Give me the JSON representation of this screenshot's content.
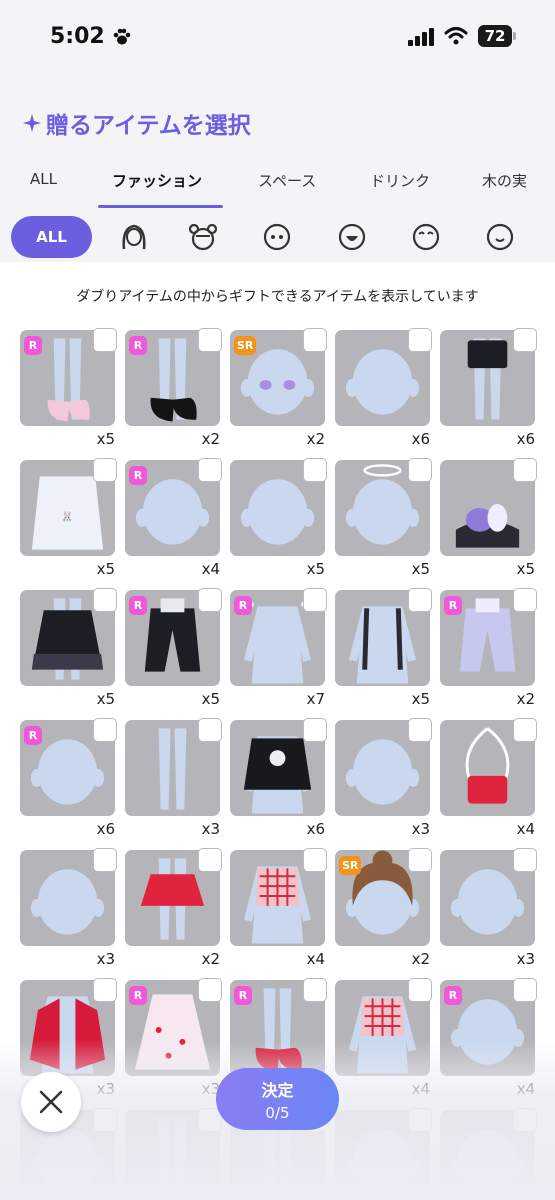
{
  "status_bar": {
    "time": "5:02",
    "battery": "72"
  },
  "header": {
    "title": "贈るアイテムを選択"
  },
  "tabs": [
    {
      "label": "ALL"
    },
    {
      "label": "ファッション"
    },
    {
      "label": "スペース"
    },
    {
      "label": "ドリンク"
    },
    {
      "label": "木の実"
    }
  ],
  "categories": {
    "all_label": "ALL",
    "icons": [
      "hair-icon",
      "face-accessory-icon",
      "eyes-icon",
      "mouth-icon",
      "brow-icon",
      "face-icon"
    ]
  },
  "notice": "ダブりアイテムの中からギフトできるアイテムを表示しています",
  "items": [
    {
      "rarity": "R",
      "count": "x5",
      "kind": "shoes-pink"
    },
    {
      "rarity": "R",
      "count": "x2",
      "kind": "shoes-black"
    },
    {
      "rarity": "SR",
      "count": "x2",
      "kind": "eyes"
    },
    {
      "rarity": "",
      "count": "x6",
      "kind": "face"
    },
    {
      "rarity": "",
      "count": "x6",
      "kind": "shorts"
    },
    {
      "rarity": "",
      "count": "x5",
      "kind": "shirt"
    },
    {
      "rarity": "R",
      "count": "x4",
      "kind": "face"
    },
    {
      "rarity": "",
      "count": "x5",
      "kind": "face"
    },
    {
      "rarity": "",
      "count": "x5",
      "kind": "halo"
    },
    {
      "rarity": "",
      "count": "x5",
      "kind": "slippers"
    },
    {
      "rarity": "",
      "count": "x5",
      "kind": "skirt-black"
    },
    {
      "rarity": "R",
      "count": "x5",
      "kind": "pants"
    },
    {
      "rarity": "R",
      "count": "x7",
      "kind": "wings-body"
    },
    {
      "rarity": "",
      "count": "x5",
      "kind": "suspender"
    },
    {
      "rarity": "R",
      "count": "x2",
      "kind": "pants-blue"
    },
    {
      "rarity": "R",
      "count": "x6",
      "kind": "face"
    },
    {
      "rarity": "",
      "count": "x3",
      "kind": "legs"
    },
    {
      "rarity": "",
      "count": "x6",
      "kind": "tshirt-black"
    },
    {
      "rarity": "",
      "count": "x3",
      "kind": "face"
    },
    {
      "rarity": "",
      "count": "x4",
      "kind": "bag"
    },
    {
      "rarity": "",
      "count": "x3",
      "kind": "face"
    },
    {
      "rarity": "",
      "count": "x2",
      "kind": "skirt-red"
    },
    {
      "rarity": "",
      "count": "x4",
      "kind": "top-check"
    },
    {
      "rarity": "SR",
      "count": "x2",
      "kind": "hair"
    },
    {
      "rarity": "",
      "count": "x3",
      "kind": "face"
    },
    {
      "rarity": "",
      "count": "x3",
      "kind": "cape"
    },
    {
      "rarity": "R",
      "count": "x3",
      "kind": "dress"
    },
    {
      "rarity": "R",
      "count": "x3",
      "kind": "shoes-red"
    },
    {
      "rarity": "",
      "count": "x4",
      "kind": "top-check"
    },
    {
      "rarity": "R",
      "count": "x4",
      "kind": "face"
    },
    {
      "rarity": "",
      "count": "",
      "kind": "face"
    },
    {
      "rarity": "",
      "count": "",
      "kind": "legs"
    },
    {
      "rarity": "",
      "count": "",
      "kind": "legs"
    },
    {
      "rarity": "",
      "count": "",
      "kind": "face"
    },
    {
      "rarity": "",
      "count": "",
      "kind": "face"
    }
  ],
  "footer": {
    "decide_label": "決定",
    "selected_count": "0/5"
  },
  "colors": {
    "accent": "#6b5fe0",
    "rarity_r": "#f157d9",
    "rarity_sr": "#f2941a",
    "tile": "#b5b5b9"
  }
}
